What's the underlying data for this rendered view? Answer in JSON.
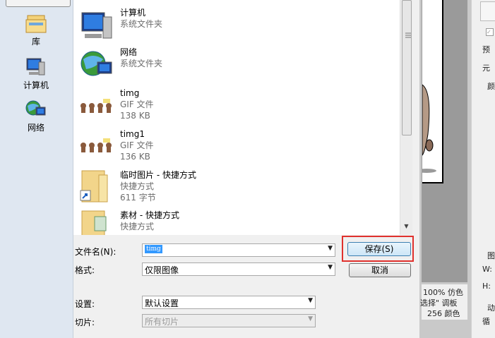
{
  "places": [
    {
      "icon": "library-icon",
      "label": "库"
    },
    {
      "icon": "computer-icon",
      "label": "计算机"
    },
    {
      "icon": "network-icon",
      "label": "网络"
    }
  ],
  "files": [
    {
      "icon": "computer-icon",
      "name": "计算机",
      "sub1": "系统文件夹",
      "sub2": ""
    },
    {
      "icon": "network-globe-icon",
      "name": "网络",
      "sub1": "系统文件夹",
      "sub2": ""
    },
    {
      "icon": "gif-thumbnail-icon",
      "name": "timg",
      "sub1": "GIF 文件",
      "sub2": "138 KB"
    },
    {
      "icon": "gif-thumbnail-icon",
      "name": "timg1",
      "sub1": "GIF 文件",
      "sub2": "136 KB"
    },
    {
      "icon": "folder-shortcut-icon",
      "name": "临时图片 - 快捷方式",
      "sub1": "快捷方式",
      "sub2": "611 字节"
    },
    {
      "icon": "folder-shortcut-icon",
      "name": "素材 - 快捷方式",
      "sub1": "快捷方式",
      "sub2": ""
    }
  ],
  "form": {
    "filename_label": "文件名(N):",
    "filename_value": "timg",
    "format_label": "格式:",
    "format_value": "仅限图像",
    "settings_label": "设置:",
    "settings_value": "默认设置",
    "slices_label": "切片:",
    "slices_value": "所有切片",
    "save_label": "保存(S)",
    "cancel_label": "取消"
  },
  "background_app": {
    "r1": "预",
    "r2": "元",
    "r3": "颜",
    "r4": "图",
    "r5": "W:",
    "r6": "H:",
    "r7": "动",
    "r8": "循",
    "stat1": "100% 仿色",
    "stat2": "选择\" 调板",
    "stat3": "256 颜色"
  },
  "colors": {
    "highlight": "#e0312d",
    "selection": "#3399ff",
    "places_bg": "#dfe7f1"
  }
}
